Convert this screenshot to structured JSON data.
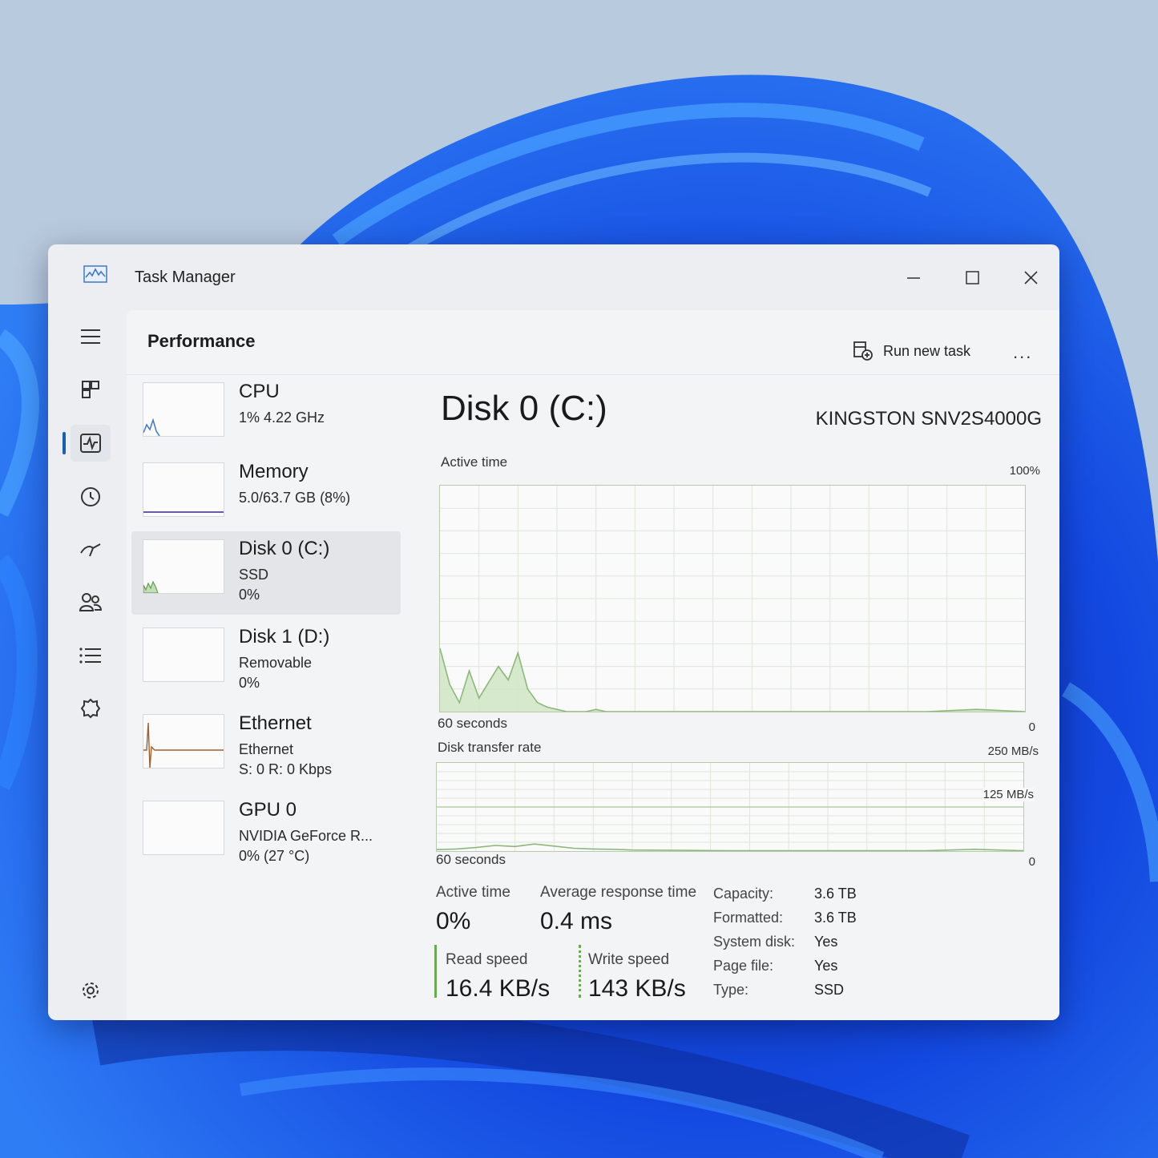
{
  "window": {
    "title": "Task Manager"
  },
  "header": {
    "page_title": "Performance",
    "run_new_task": "Run new task",
    "more": "..."
  },
  "sidebar": {
    "items": [
      {
        "name": "CPU",
        "sub1": "1% 4.22 GHz",
        "sub2": "",
        "sub3": ""
      },
      {
        "name": "Memory",
        "sub1": "5.0/63.7 GB (8%)",
        "sub2": "",
        "sub3": ""
      },
      {
        "name": "Disk 0 (C:)",
        "sub1": "SSD",
        "sub2": "0%",
        "sub3": ""
      },
      {
        "name": "Disk 1 (D:)",
        "sub1": "Removable",
        "sub2": "0%",
        "sub3": ""
      },
      {
        "name": "Ethernet",
        "sub1": "Ethernet",
        "sub2": "S: 0 R: 0 Kbps",
        "sub3": ""
      },
      {
        "name": "GPU 0",
        "sub1": "NVIDIA GeForce R...",
        "sub2": "0% (27 °C)",
        "sub3": ""
      }
    ],
    "selected": "Disk 0 (C:)"
  },
  "detail": {
    "title": "Disk 0 (C:)",
    "model": "KINGSTON SNV2S4000G",
    "chart1": {
      "label": "Active time",
      "max": "100%",
      "min": "0",
      "time": "60 seconds"
    },
    "chart2": {
      "label": "Disk transfer rate",
      "max": "250 MB/s",
      "mid": "125 MB/s",
      "min": "0",
      "time": "60 seconds"
    },
    "stats": {
      "active_time_label": "Active time",
      "active_time_value": "0%",
      "avg_response_label": "Average response time",
      "avg_response_value": "0.4 ms",
      "read_label": "Read speed",
      "read_value": "16.4 KB/s",
      "write_label": "Write speed",
      "write_value": "143 KB/s"
    },
    "properties": [
      {
        "key": "Capacity:",
        "value": "3.6 TB"
      },
      {
        "key": "Formatted:",
        "value": "3.6 TB"
      },
      {
        "key": "System disk:",
        "value": "Yes"
      },
      {
        "key": "Page file:",
        "value": "Yes"
      },
      {
        "key": "Type:",
        "value": "SSD"
      }
    ]
  },
  "colors": {
    "disk_green": "#8cb87a",
    "accent": "#1a5fb4",
    "cpu_blue": "#3d78c9",
    "ethernet_brown": "#a0602e"
  },
  "icons": [
    "app-icon",
    "minimize-icon",
    "maximize-icon",
    "close-icon",
    "hamburger-icon",
    "processes-icon",
    "performance-icon",
    "app-history-icon",
    "startup-apps-icon",
    "users-icon",
    "details-icon",
    "services-icon",
    "settings-icon",
    "run-task-icon"
  ],
  "chart_data": [
    {
      "type": "area",
      "title": "Active time",
      "xlabel": "60 seconds",
      "ylim": [
        0,
        100
      ],
      "x": [
        60,
        59,
        58,
        57,
        56,
        55,
        54,
        53,
        52,
        51,
        50,
        49,
        48,
        47,
        46,
        45,
        44,
        43,
        42,
        41,
        40,
        30,
        20,
        10,
        5,
        0
      ],
      "values": [
        28,
        12,
        4,
        18,
        6,
        13,
        20,
        14,
        26,
        10,
        4,
        2,
        1,
        0,
        0,
        0,
        1,
        0,
        0,
        0,
        0,
        0,
        0,
        0,
        1,
        0
      ]
    },
    {
      "type": "line",
      "title": "Disk transfer rate",
      "xlabel": "60 seconds",
      "ylim": [
        0,
        250
      ],
      "x": [
        60,
        58,
        56,
        54,
        52,
        50,
        48,
        46,
        44,
        42,
        40,
        35,
        30,
        20,
        10,
        5,
        0
      ],
      "values": [
        4,
        6,
        10,
        16,
        13,
        20,
        14,
        8,
        6,
        5,
        3,
        2,
        1,
        1,
        1,
        5,
        1
      ]
    }
  ]
}
